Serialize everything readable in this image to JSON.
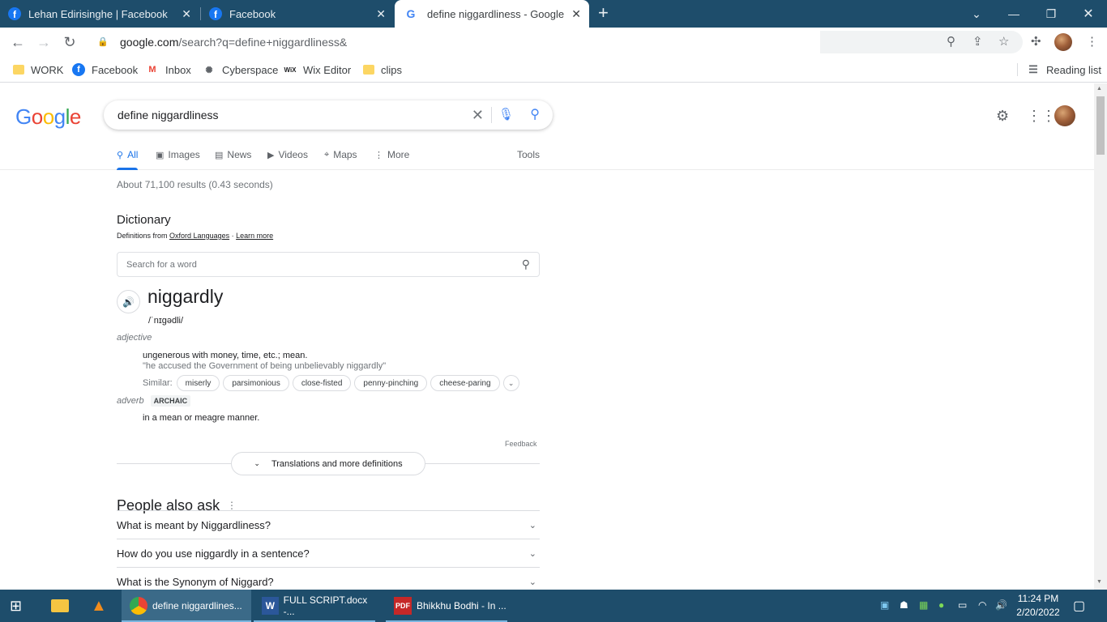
{
  "browser": {
    "tabs": [
      {
        "title": "Lehan Edirisinghe | Facebook"
      },
      {
        "title": "Facebook"
      },
      {
        "title": "define niggardliness - Google Se"
      }
    ],
    "url_host": "google.com",
    "url_path": "/search?q=define+niggardliness&",
    "bookmarks": [
      "WORK",
      "Facebook",
      "Inbox",
      "Cyberspace",
      "Wix Editor",
      "clips"
    ],
    "reading_list": "Reading list"
  },
  "google": {
    "logo": "Google",
    "query": "define niggardliness",
    "tabs": [
      "All",
      "Images",
      "News",
      "Videos",
      "Maps",
      "More"
    ],
    "tools": "Tools",
    "results_count": "About 71,100 results (0.43 seconds)"
  },
  "dictionary": {
    "title": "Dictionary",
    "from_prefix": "Definitions from",
    "source": "Oxford Languages",
    "learn_more": "Learn more",
    "search_placeholder": "Search for a word",
    "word": "niggardly",
    "phonetic": "/ˈnɪɡədli/",
    "pos1": "adjective",
    "definition1": "ungenerous with money, time, etc.; mean.",
    "example1": "\"he accused the Government of being unbelievably niggardly\"",
    "similar_label": "Similar:",
    "similar": [
      "miserly",
      "parsimonious",
      "close-fisted",
      "penny-pinching",
      "cheese-paring"
    ],
    "pos2": "adverb",
    "tag2": "ARCHAIC",
    "definition2": "in a mean or meagre manner.",
    "feedback": "Feedback",
    "translations": "Translations and more definitions"
  },
  "people_also_ask": {
    "title": "People also ask",
    "questions": [
      "What is meant by Niggardliness?",
      "How do you use niggardly in a sentence?",
      "What is the Synonym of Niggard?"
    ]
  },
  "taskbar": {
    "apps": [
      {
        "label": "define niggardlines..."
      },
      {
        "label": "FULL SCRIPT.docx -..."
      },
      {
        "label": "Bhikkhu Bodhi - In ..."
      }
    ],
    "time": "11:24 PM",
    "date": "2/20/2022"
  },
  "colors": {
    "titlebar": "#1e4d6b",
    "link_blue": "#1a73e8",
    "google_blue": "#4285f4",
    "google_red": "#ea4335",
    "google_yellow": "#fbbc05",
    "google_green": "#34a853"
  }
}
